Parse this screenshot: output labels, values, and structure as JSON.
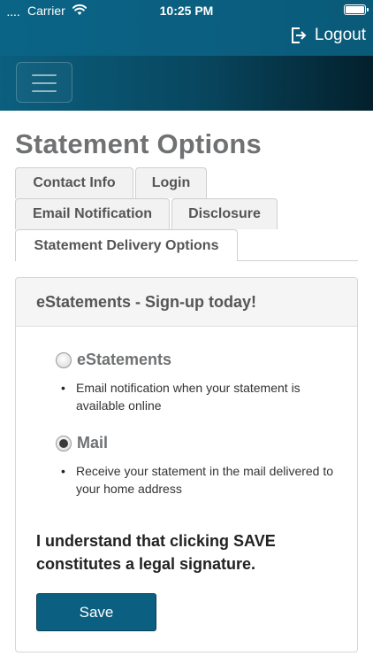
{
  "status_bar": {
    "signal": "....",
    "carrier": "Carrier",
    "time": "10:25 PM"
  },
  "header": {
    "logout_label": "Logout",
    "logout_icon": "logout-icon",
    "menu_icon": "hamburger-icon"
  },
  "page": {
    "title": "Statement Options"
  },
  "tabs": [
    {
      "label": "Contact Info",
      "active": false
    },
    {
      "label": "Login",
      "active": false
    },
    {
      "label": "Email Notification",
      "active": false
    },
    {
      "label": "Disclosure",
      "active": false
    },
    {
      "label": "Statement Delivery Options",
      "active": true
    }
  ],
  "card": {
    "title": "eStatements - Sign-up today!",
    "options": [
      {
        "label": "eStatements",
        "selected": false,
        "description": "Email notification when your statement is available online"
      },
      {
        "label": "Mail",
        "selected": true,
        "description": "Receive your statement in the mail delivered to your home address"
      }
    ],
    "legal_text": "I understand that clicking SAVE constitutes a legal signature.",
    "save_label": "Save"
  },
  "colors": {
    "header_bg": "#0b5f80",
    "nav_bg_dark": "#03202c",
    "primary_button": "#0b5f80",
    "title_text": "#6f7173"
  }
}
